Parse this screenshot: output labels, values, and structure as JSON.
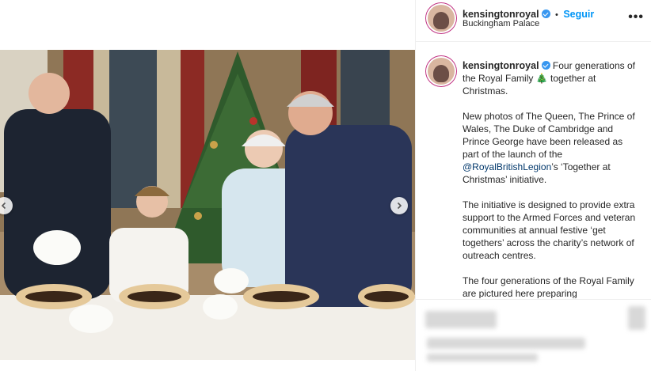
{
  "post": {
    "username": "kensingtonroyal",
    "location": "Buckingham Palace",
    "follow_label": "Seguir",
    "separator": "•",
    "more_label": "•••",
    "caption": {
      "username": "kensingtonroyal",
      "line1_text": "Four generations of the Royal Family",
      "tree_emoji": "🎄",
      "line1_end": "together at Christmas.",
      "para2_before": "New photos of The Queen, The Prince of Wales, The Duke of Cambridge and Prince George have been released as part of the launch of the",
      "para2_mention": "@RoyalBritishLegion",
      "para2_after": "’s ‘Together at Christmas’ initiative.",
      "para3": "The initiative is designed to provide extra support to the Armed Forces and veteran communities at annual festive ‘get togethers’ across the charity’s network of outreach centres.",
      "para4": "The four generations of the Royal Family are pictured here preparing"
    }
  },
  "colors": {
    "verified": "#3897f0",
    "follow": "#0095f6",
    "mention": "#00376b",
    "story_ring": "#c13584"
  },
  "icons": {
    "prev": "chevron-left-icon",
    "next": "chevron-right-icon",
    "verified": "verified-badge-icon",
    "more": "more-options-icon"
  }
}
